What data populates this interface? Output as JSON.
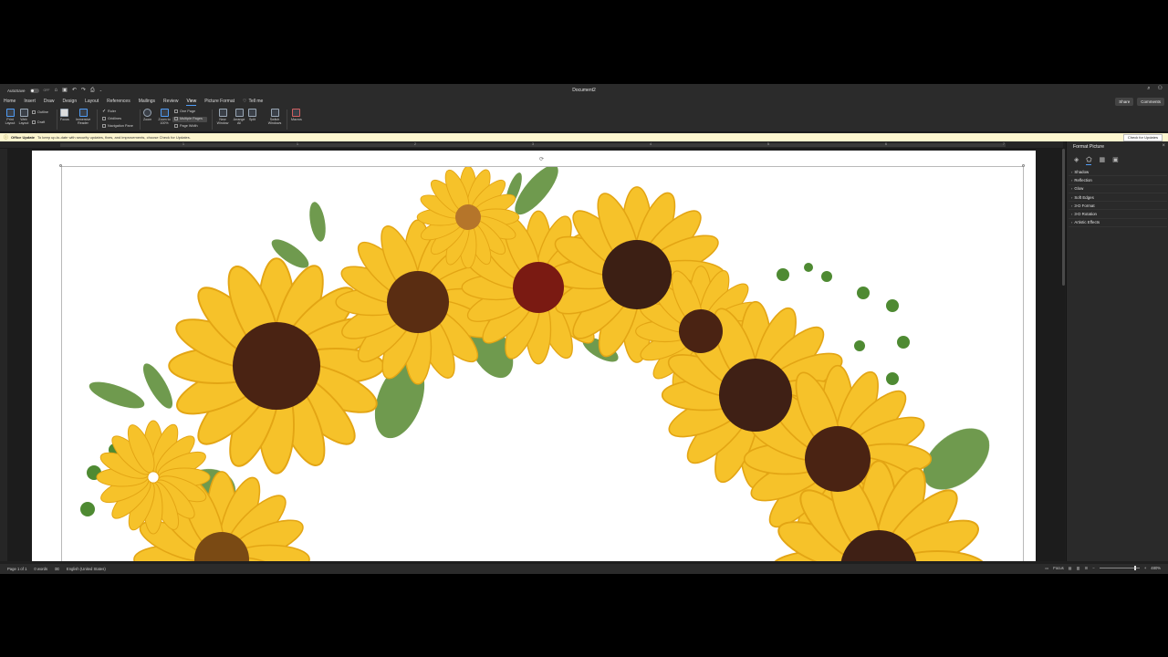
{
  "titlebar": {
    "autosave_label": "AutoSave",
    "autosave_state": "OFF",
    "doc_title": "Document2"
  },
  "tabs": {
    "items": [
      "Home",
      "Insert",
      "Draw",
      "Design",
      "Layout",
      "References",
      "Mailings",
      "Review",
      "View",
      "Picture Format"
    ],
    "tell_me": "Tell me",
    "share": "Share",
    "comments": "Comments"
  },
  "ribbon": {
    "print_layout": "Print Layout",
    "web_layout": "Web Layout",
    "outline": "Outline",
    "draft": "Draft",
    "focus": "Focus",
    "immersive_reader": "Immersive Reader",
    "ruler": "Ruler",
    "gridlines": "Gridlines",
    "navigation_pane": "Navigation Pane",
    "zoom": "Zoom",
    "zoom_100": "Zoom to 100%",
    "one_page": "One Page",
    "multiple_pages": "Multiple Pages",
    "page_width": "Page Width",
    "new_window": "New Window",
    "arrange_all": "Arrange All",
    "split": "Split",
    "switch_windows": "Switch Windows",
    "macros": "Macros"
  },
  "update_bar": {
    "title": "Office Update",
    "message": "To keep up-to-date with security updates, fixes, and improvements, choose Check for Updates.",
    "button": "Check for Updates"
  },
  "ruler_numbers": [
    "1",
    "1",
    "2",
    "3",
    "4",
    "5",
    "6",
    "7"
  ],
  "pane": {
    "title": "Format Picture",
    "items": [
      "Shadow",
      "Reflection",
      "Glow",
      "Soft Edges",
      "3-D Format",
      "3-D Rotation",
      "Artistic Effects"
    ]
  },
  "status": {
    "page": "Page 1 of 1",
    "words": "0 words",
    "language": "English (United States)",
    "focus": "Focus",
    "zoom": "480%"
  },
  "colors": {
    "accent": "#4f9cf5",
    "update_bar": "#fdf6cf",
    "chrome": "#2b2b2b"
  }
}
